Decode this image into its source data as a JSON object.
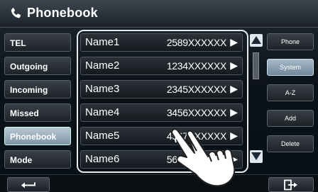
{
  "header": {
    "title": "Phonebook",
    "icon": "phone-icon"
  },
  "left_menu": [
    {
      "label": "TEL",
      "active": false
    },
    {
      "label": "Outgoing",
      "active": false
    },
    {
      "label": "Incoming",
      "active": false
    },
    {
      "label": "Missed",
      "active": false
    },
    {
      "label": "Phonebook",
      "active": true
    },
    {
      "label": "Mode",
      "active": false
    }
  ],
  "contacts": [
    {
      "name": "Name1",
      "number": "2589XXXXXX"
    },
    {
      "name": "Name2",
      "number": "1234XXXXXX"
    },
    {
      "name": "Name3",
      "number": "2345XXXXXX"
    },
    {
      "name": "Name4",
      "number": "3456XXXXXX"
    },
    {
      "name": "Name5",
      "number": "4567XXXXXX"
    },
    {
      "name": "Name6",
      "number": "5678XXXXXX"
    }
  ],
  "right_panel": [
    {
      "label": "Phone",
      "active": false
    },
    {
      "label": "System",
      "active": true
    },
    {
      "label": "A-Z",
      "active": false
    },
    {
      "label": "Add",
      "active": false
    },
    {
      "label": "Delete",
      "active": false
    }
  ],
  "colors": {
    "accent": "#8aa3b6",
    "frame": "#e8e8e8",
    "background": "#0b1218"
  }
}
